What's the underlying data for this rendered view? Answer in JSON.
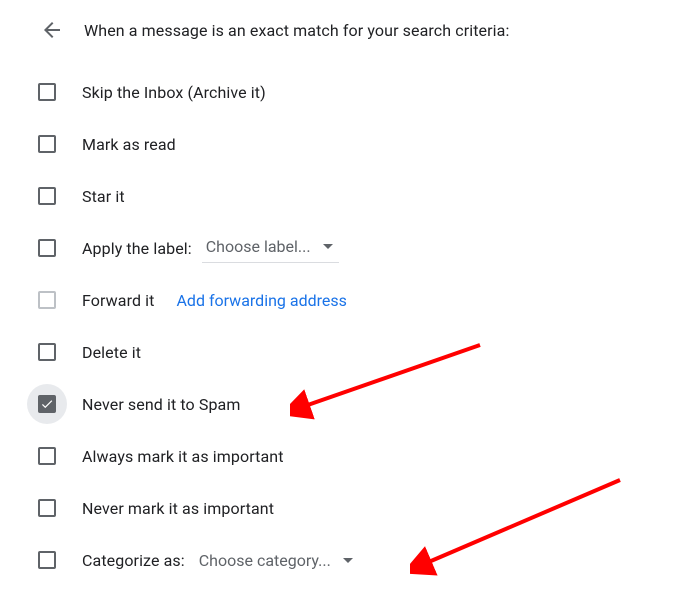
{
  "header": {
    "title": "When a message is an exact match for your search criteria:"
  },
  "options": {
    "skip_inbox": "Skip the Inbox (Archive it)",
    "mark_read": "Mark as read",
    "star": "Star it",
    "apply_label": "Apply the label:",
    "apply_label_dropdown": "Choose label...",
    "forward": "Forward it",
    "forward_link": "Add forwarding address",
    "delete": "Delete it",
    "never_spam": "Never send it to Spam",
    "always_important": "Always mark it as important",
    "never_important": "Never mark it as important",
    "categorize": "Categorize as:",
    "categorize_dropdown": "Choose category..."
  }
}
